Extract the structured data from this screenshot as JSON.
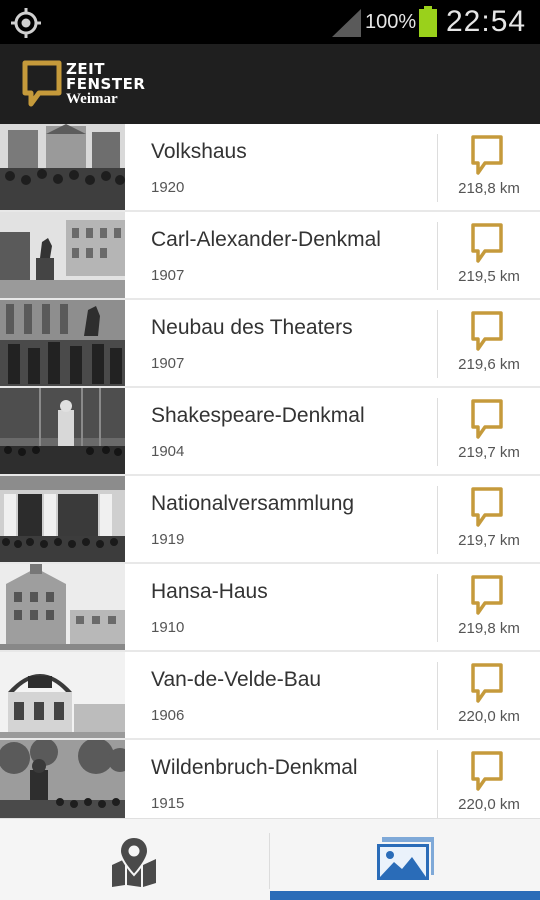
{
  "status_bar": {
    "battery_percent": "100%",
    "time": "22:54",
    "battery_color": "#9ad11b"
  },
  "app_bar": {
    "logo_line1": "ZEIT",
    "logo_line2": "FENSTER",
    "logo_line3": "Weimar",
    "accent_color": "#c59a3b"
  },
  "list": {
    "items": [
      {
        "title": "Volkshaus",
        "year": "1920",
        "distance": "218,8 km",
        "thumb": "crowd-facade"
      },
      {
        "title": "Carl-Alexander-Denkmal",
        "year": "1907",
        "distance": "219,5 km",
        "thumb": "statue-square"
      },
      {
        "title": "Neubau des Theaters",
        "year": "1907",
        "distance": "219,6 km",
        "thumb": "theater-crowd"
      },
      {
        "title": "Shakespeare-Denkmal",
        "year": "1904",
        "distance": "219,7 km",
        "thumb": "monument-crowd"
      },
      {
        "title": "Nationalversammlung",
        "year": "1919",
        "distance": "219,7 km",
        "thumb": "columns-crowd"
      },
      {
        "title": "Hansa-Haus",
        "year": "1910",
        "distance": "219,8 km",
        "thumb": "corner-building"
      },
      {
        "title": "Van-de-Velde-Bau",
        "year": "1906",
        "distance": "220,0 km",
        "thumb": "pavilion"
      },
      {
        "title": "Wildenbruch-Denkmal",
        "year": "1915",
        "distance": "220,0 km",
        "thumb": "park-monument"
      }
    ]
  },
  "tabs": [
    {
      "name": "map",
      "icon": "map-pin-icon",
      "selected": false
    },
    {
      "name": "gallery",
      "icon": "image-gallery-icon",
      "selected": true
    }
  ],
  "tab_indicator_color": "#2a6cb8"
}
